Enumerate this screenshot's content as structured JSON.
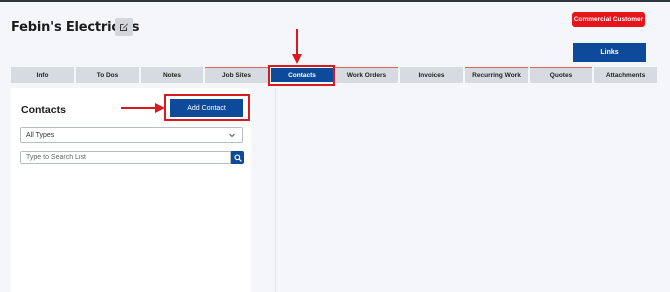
{
  "header": {
    "title": "Febin's Electricals",
    "badge": "Commercial Customer",
    "links_label": "Links"
  },
  "tabs": [
    {
      "label": "Info"
    },
    {
      "label": "To Dos"
    },
    {
      "label": "Notes"
    },
    {
      "label": "Job Sites"
    },
    {
      "label": "Contacts",
      "active": true
    },
    {
      "label": "Work Orders"
    },
    {
      "label": "Invoices"
    },
    {
      "label": "Recurring Work"
    },
    {
      "label": "Quotes"
    },
    {
      "label": "Attachments"
    }
  ],
  "contacts_panel": {
    "title": "Contacts",
    "add_button": "Add Contact",
    "type_filter": "All Types",
    "search_placeholder": "Type to Search List"
  },
  "colors": {
    "primary": "#0d4a9a",
    "badge_red": "#e8141b",
    "annotation_red": "#d71920",
    "tab_gray": "#d6dbe1"
  },
  "icons": [
    "edit-icon",
    "chevron-down-icon",
    "search-icon",
    "annotation-arrow-down",
    "annotation-arrow-right"
  ]
}
